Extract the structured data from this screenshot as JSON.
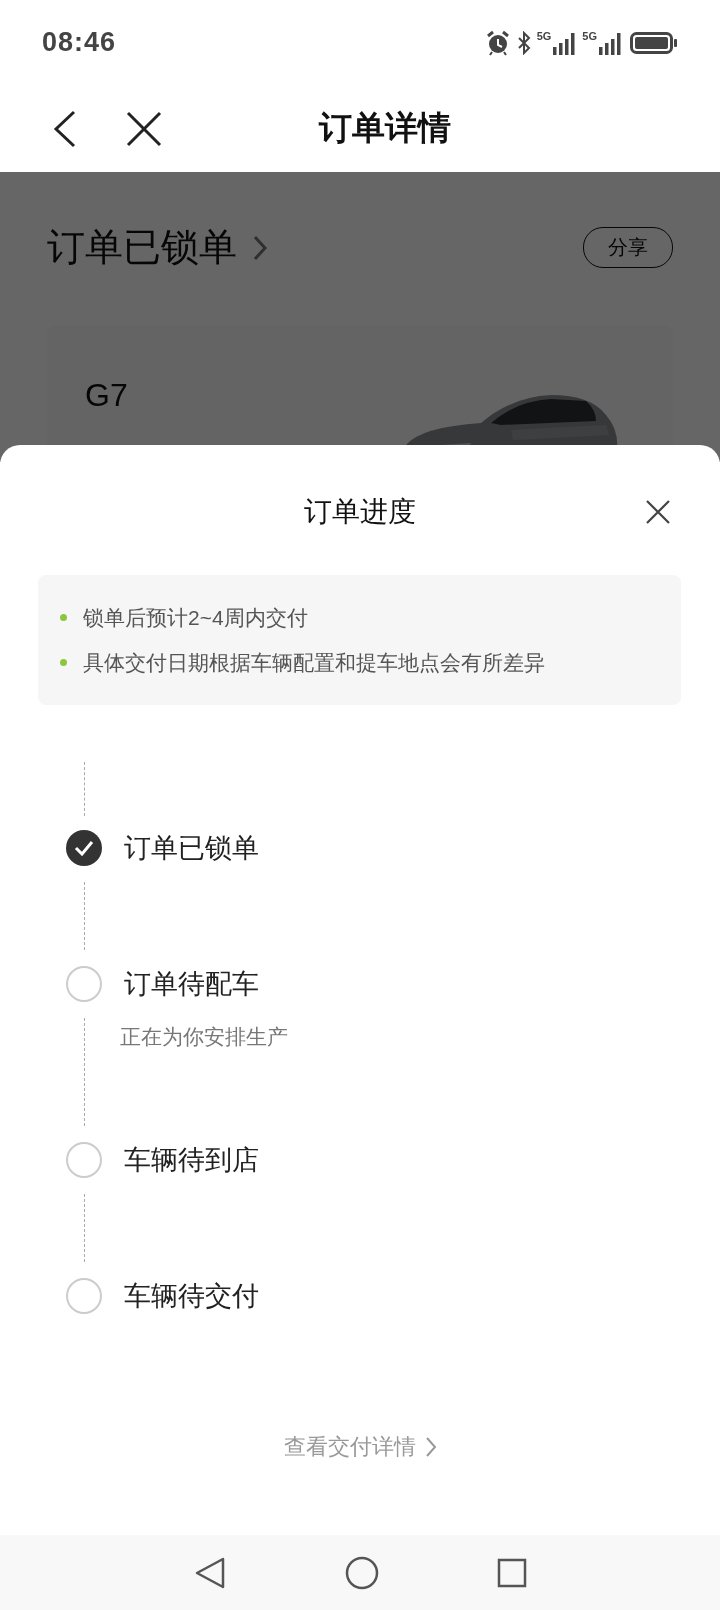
{
  "status_bar": {
    "time": "08:46",
    "networks": [
      "5G",
      "5G"
    ]
  },
  "header": {
    "title": "订单详情"
  },
  "background_page": {
    "status": "订单已锁单",
    "share_button": "分享",
    "car_card": {
      "model": "G7"
    }
  },
  "progress_sheet": {
    "title": "订单进度",
    "notes": [
      "锁单后预计2~4周内交付",
      "具体交付日期根据车辆配置和提车地点会有所差异"
    ],
    "steps": [
      {
        "label": "订单已锁单",
        "done": true
      },
      {
        "label": "订单待配车",
        "done": false,
        "subtitle": "正在为你安排生产"
      },
      {
        "label": "车辆待到店",
        "done": false
      },
      {
        "label": "车辆待交付",
        "done": false
      }
    ],
    "link": "查看交付详情"
  }
}
